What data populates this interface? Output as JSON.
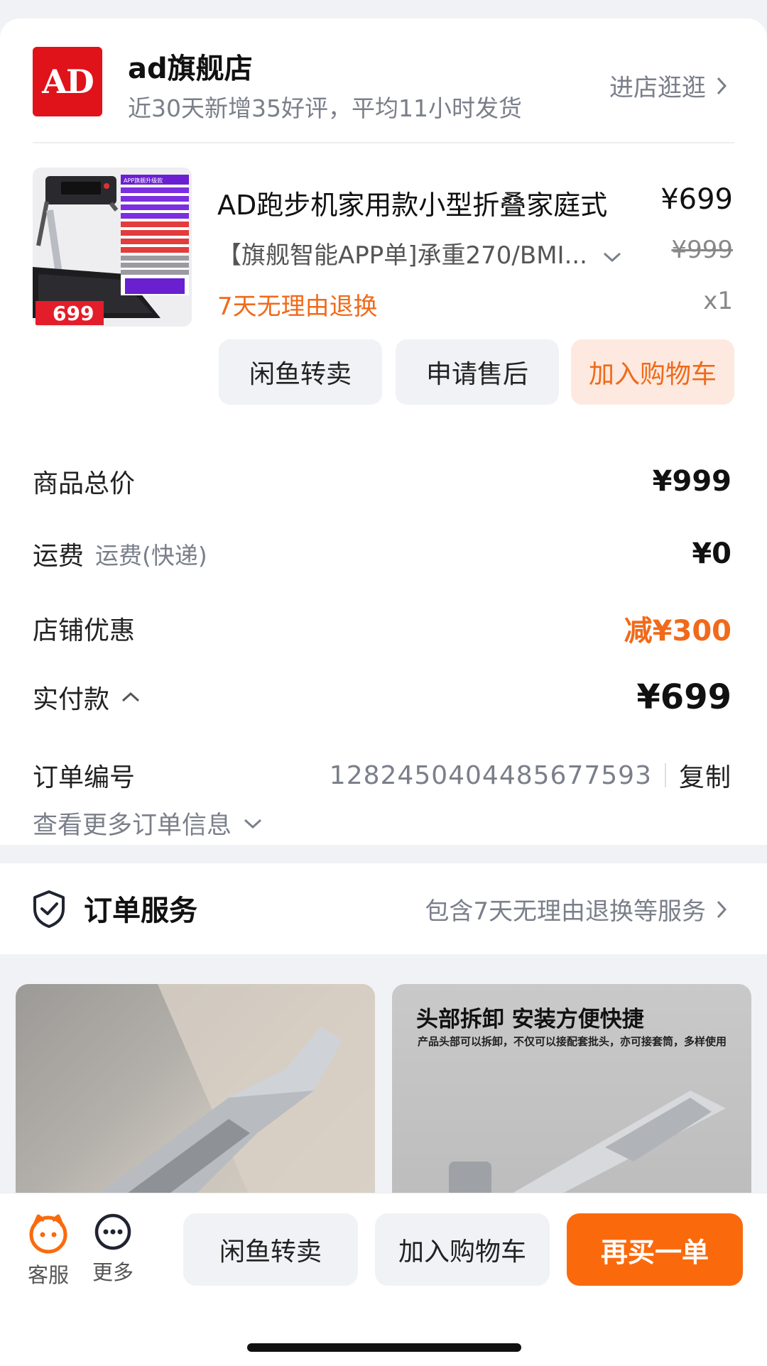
{
  "store": {
    "logo_text": "AD",
    "name": "ad旗舰店",
    "subtitle": "近30天新增35好评，平均11小时发货",
    "enter_link": "进店逛逛"
  },
  "product": {
    "title": "AD跑步机家用款小型折叠家庭式",
    "price": "¥699",
    "spec": "【旗舰智能APP单]承重270/BMI...",
    "original_price": "¥999",
    "badge": "7天无理由退换",
    "quantity": "x1",
    "image_price_tag": "699",
    "image_caption": "APP旗舰升级款"
  },
  "product_actions": {
    "resell": "闲鱼转卖",
    "after_sale": "申请售后",
    "add_cart": "加入购物车"
  },
  "summary": {
    "total_label": "商品总价",
    "total_value": "¥999",
    "shipping_label": "运费",
    "shipping_sub": "运费(快递)",
    "shipping_value": "¥0",
    "discount_label": "店铺优惠",
    "discount_value": "减¥300",
    "paid_label": "实付款",
    "paid_value": "¥699",
    "order_no_label": "订单编号",
    "order_no": "1282450404485677593",
    "copy": "复制",
    "more_info": "查看更多订单信息"
  },
  "service": {
    "title": "订单服务",
    "link": "包含7天无理由退换等服务"
  },
  "recommendations": {
    "item2_title": "头部拆卸 安装方便快捷",
    "item2_sub": "产品头部可以拆卸，不仅可以接配套批头，亦可接套筒，多样使用"
  },
  "bottom_bar": {
    "service_label": "客服",
    "more_label": "更多",
    "resell": "闲鱼转卖",
    "add_cart": "加入购物车",
    "rebuy": "再买一单"
  },
  "colors": {
    "accent": "#fa6a0d",
    "discount": "#f06a1a",
    "logo_red": "#e0121a"
  }
}
